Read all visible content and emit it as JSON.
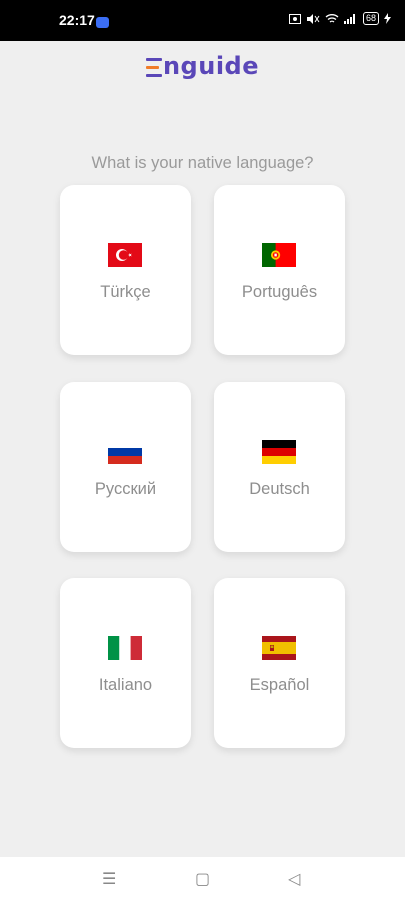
{
  "status_bar": {
    "time": "22:17",
    "battery": "68",
    "icons": [
      "screenshot-icon",
      "mute-icon",
      "wifi-icon",
      "signal-icon",
      "charging-icon"
    ]
  },
  "app": {
    "logo_text": "nguide",
    "brand_color": "#5a47b8",
    "accent_color": "#f07c2a"
  },
  "main": {
    "question": "What is your native language?",
    "languages": [
      {
        "label": "Türkçe",
        "flag": "turkey-flag"
      },
      {
        "label": "Português",
        "flag": "portugal-flag"
      },
      {
        "label": "Русский",
        "flag": "russia-flag"
      },
      {
        "label": "Deutsch",
        "flag": "germany-flag"
      },
      {
        "label": "Italiano",
        "flag": "italy-flag"
      },
      {
        "label": "Español",
        "flag": "spain-flag"
      }
    ]
  },
  "nav_bar": {
    "menu_glyph": "☰",
    "home_glyph": "▢",
    "back_glyph": "◁"
  }
}
